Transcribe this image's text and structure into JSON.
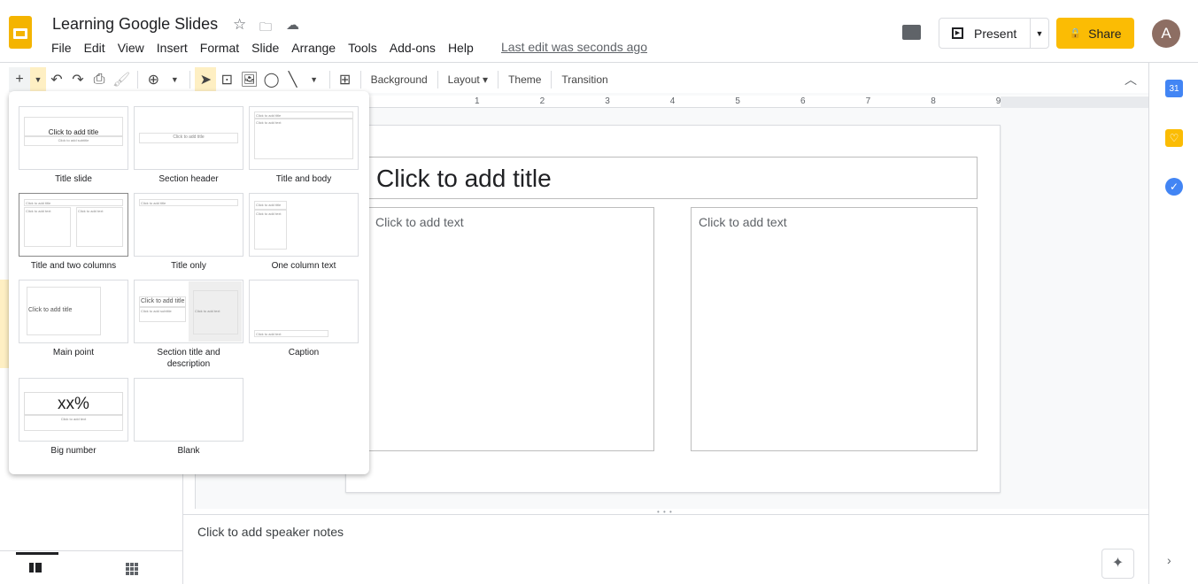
{
  "header": {
    "title": "Learning Google Slides",
    "last_edit": "Last edit was seconds ago",
    "present_label": "Present",
    "share_label": "Share",
    "avatar_letter": "A"
  },
  "menu": [
    "File",
    "Edit",
    "View",
    "Insert",
    "Format",
    "Slide",
    "Arrange",
    "Tools",
    "Add-ons",
    "Help"
  ],
  "toolbar": {
    "background": "Background",
    "layout": "Layout",
    "theme": "Theme",
    "transition": "Transition"
  },
  "ruler": [
    "1",
    "2",
    "3",
    "4",
    "5",
    "6",
    "7",
    "8",
    "9"
  ],
  "slide": {
    "title_placeholder": "Click to add title",
    "col1_placeholder": "Click to add text",
    "col2_placeholder": "Click to add text"
  },
  "notes": {
    "placeholder": "Click to add speaker notes"
  },
  "side_panel": {
    "calendar_day": "31"
  },
  "layouts": [
    {
      "label": "Title slide",
      "kind": "title",
      "t1": "Click to add title",
      "t2": "Click to add subtitle"
    },
    {
      "label": "Section header",
      "kind": "section",
      "t1": "Click to add title"
    },
    {
      "label": "Title and body",
      "kind": "body",
      "t1": "Click to add title",
      "t2": "Click to add text"
    },
    {
      "label": "Title and two columns",
      "kind": "two",
      "t1": "Click to add title",
      "t2": "Click to add text",
      "selected": true
    },
    {
      "label": "Title only",
      "kind": "only",
      "t1": "Click to add title"
    },
    {
      "label": "One column text",
      "kind": "onecol",
      "t1": "Click to add title",
      "t2": "Click to add text"
    },
    {
      "label": "Main point",
      "kind": "main",
      "t1": "Click to add title"
    },
    {
      "label": "Section title and description",
      "kind": "secdesc",
      "t1": "Click to add title",
      "t2": "Click to add subtitle",
      "t3": "Click to add text"
    },
    {
      "label": "Caption",
      "kind": "caption",
      "t1": "Click to add text"
    },
    {
      "label": "Big number",
      "kind": "big",
      "t1": "xx%",
      "t2": "Click to add text"
    },
    {
      "label": "Blank",
      "kind": "blank"
    }
  ],
  "colors": {
    "accent": "#fbbc04",
    "selected_tool": "#feefc3",
    "avatar": "#8d6e63"
  }
}
